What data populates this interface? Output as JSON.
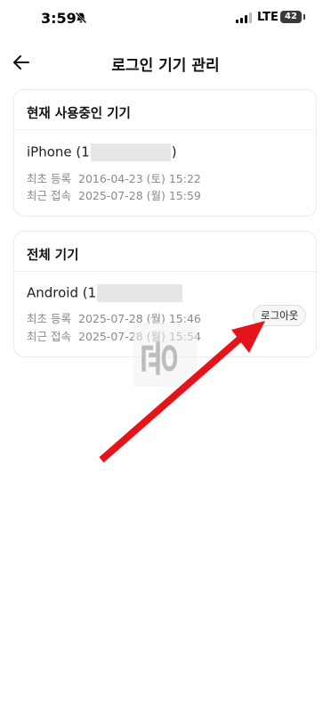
{
  "status": {
    "time": "3:59",
    "network": "LTE",
    "battery": "42",
    "icons": [
      "bell-off-icon",
      "signal-icon",
      "battery-icon"
    ]
  },
  "header": {
    "title": "로그인 기기 관리",
    "back_icon": "back-arrow-icon"
  },
  "current_device": {
    "section_title": "현재 사용중인 기기",
    "name_prefix": "iPhone (1",
    "name_suffix": ")",
    "registered_label": "최초 등록",
    "registered_value": "2016-04-23 (토) 15:22",
    "last_access_label": "최근 접속",
    "last_access_value": "2025-07-28 (월) 15:59"
  },
  "all_devices": {
    "section_title": "전체 기기",
    "devices": [
      {
        "name_prefix": "Android (1",
        "registered_label": "최초 등록",
        "registered_value": "2025-07-28 (월) 15:46",
        "last_access_label": "최근 접속",
        "last_access_value": "2025-07-28 (월) 15:54",
        "logout_label": "로그아웃"
      }
    ]
  },
  "overlay": {
    "watermark_text": "윤",
    "arrow_color": "#e5141b"
  }
}
